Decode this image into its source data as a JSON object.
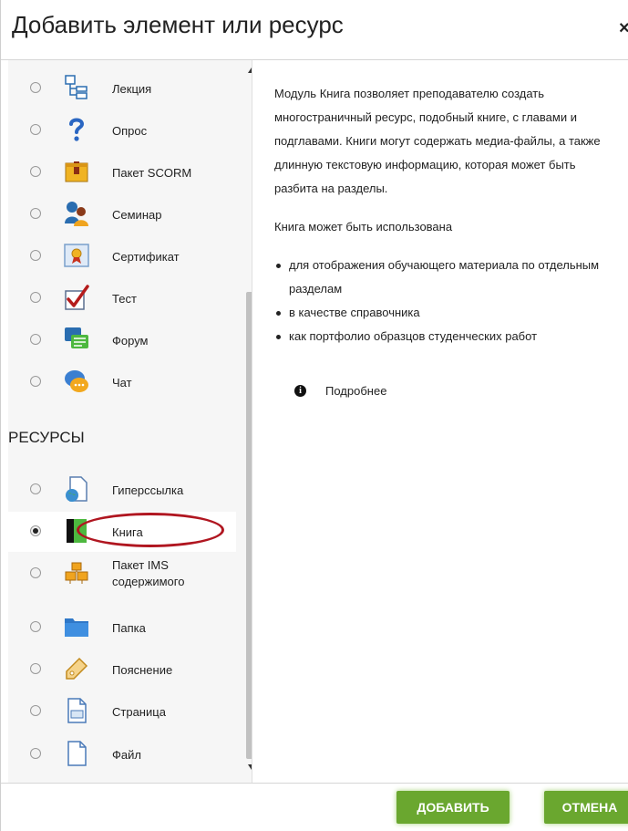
{
  "dialog": {
    "title": "Добавить элемент или ресурс",
    "close_label": "×"
  },
  "activities": [
    {
      "label": "Лекция",
      "icon": "lesson-icon",
      "checked": false
    },
    {
      "label": "Опрос",
      "icon": "question-icon",
      "checked": false
    },
    {
      "label": "Пакет SCORM",
      "icon": "scorm-package-icon",
      "checked": false
    },
    {
      "label": "Семинар",
      "icon": "workshop-icon",
      "checked": false
    },
    {
      "label": "Сертификат",
      "icon": "certificate-icon",
      "checked": false
    },
    {
      "label": "Тест",
      "icon": "quiz-checkmark-icon",
      "checked": false
    },
    {
      "label": "Форум",
      "icon": "forum-icon",
      "checked": false
    },
    {
      "label": "Чат",
      "icon": "chat-icon",
      "checked": false
    }
  ],
  "resources_heading": "РЕСУРСЫ",
  "resources": [
    {
      "label": "Гиперссылка",
      "icon": "url-icon",
      "checked": false
    },
    {
      "label": "Книга",
      "icon": "book-icon",
      "checked": true
    },
    {
      "label_line1": "Пакет IMS",
      "label_line2": "содержимого",
      "icon": "ims-package-icon",
      "checked": false
    },
    {
      "label": "Папка",
      "icon": "folder-icon",
      "checked": false
    },
    {
      "label": "Пояснение",
      "icon": "label-tag-icon",
      "checked": false
    },
    {
      "label": "Страница",
      "icon": "page-icon",
      "checked": false
    },
    {
      "label": "Файл",
      "icon": "file-icon",
      "checked": false
    }
  ],
  "description": {
    "paragraph1": "Модуль Книга позволяет преподавателю создать многостраничный ресурс, подобный книге, с главами и подглавами. Книги могут содержать медиа-файлы, а также длинную текстовую информацию, которая может быть разбита на разделы.",
    "paragraph2": "Книга может быть использована",
    "bullets": [
      "для отображения обучающего материала по отдельным разделам",
      "в качестве справочника",
      "как портфолио образцов студенческих работ"
    ],
    "more_icon": "i",
    "more_link": "Подробнее"
  },
  "footer": {
    "add_label": "Добавить",
    "cancel_label": "Отмена"
  },
  "colors": {
    "button_green": "#6aa72f",
    "highlight_red": "#b01620",
    "list_background": "#f6f6f6"
  }
}
